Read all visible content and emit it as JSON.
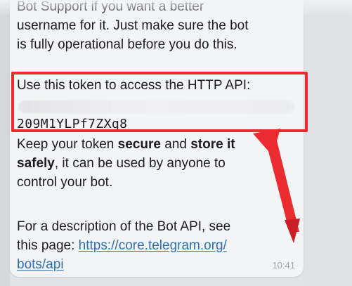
{
  "message": {
    "intro_line1": "Bot Support if you want a better",
    "intro_line2": "username for it. Just make sure the bot",
    "intro_line3": "is fully operational before you do this.",
    "token_title": "Use this token to access the HTTP API:",
    "token_visible_tail": "209M1YLPf7ZXq8",
    "keep_line1_a": "Keep your token ",
    "keep_line1_b": "secure",
    "keep_line1_c": " and ",
    "keep_line1_d": "store it",
    "keep_line2_a": "safely",
    "keep_line2_b": ", it can be used by anyone to",
    "keep_line3": "control your bot.",
    "desc_line1": "For a description of the Bot API, see",
    "desc_line2_prefix": "this page: ",
    "desc_link_line1": "https://core.telegram.org/",
    "desc_link_line2": "bots/api",
    "time": "10:41"
  },
  "colors": {
    "highlight": "#ea2b2f",
    "link": "#2f6fb2",
    "bubble": "#f3f4f5"
  }
}
